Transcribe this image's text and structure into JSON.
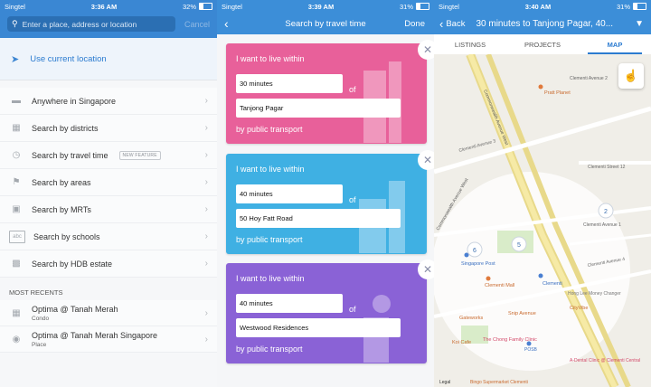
{
  "panel1": {
    "status": {
      "carrier": "Singtel",
      "time": "3:36 AM",
      "battery": "32%",
      "battery_level": 0.32
    },
    "search": {
      "placeholder": "Enter a place, address or location",
      "cancel": "Cancel"
    },
    "use_location": "Use current location",
    "menu": [
      {
        "label": "Anywhere in Singapore",
        "icon": "singapore-map-icon"
      },
      {
        "label": "Search by districts",
        "icon": "grid-icon"
      },
      {
        "label": "Search by travel time",
        "icon": "clock-icon",
        "badge": "NEW FEATURE"
      },
      {
        "label": "Search by areas",
        "icon": "area-icon"
      },
      {
        "label": "Search by MRTs",
        "icon": "train-icon"
      },
      {
        "label": "Search by schools",
        "icon": "school-icon"
      },
      {
        "label": "Search by HDB estate",
        "icon": "hdb-icon"
      }
    ],
    "recents_header": "MOST RECENTS",
    "recents": [
      {
        "title": "Optima @ Tanah Merah",
        "subtitle": "Condo"
      },
      {
        "title": "Optima @ Tanah Merah Singapore",
        "subtitle": "Place"
      }
    ]
  },
  "panel2": {
    "status": {
      "carrier": "Singtel",
      "time": "3:39 AM",
      "battery": "31%",
      "battery_level": 0.31
    },
    "title": "Search by travel time",
    "done": "Done",
    "cards": [
      {
        "intro": "I want to live within",
        "duration": "30 minutes",
        "of": "of",
        "place": "Tanjong Pagar",
        "mode": "by public transport",
        "color": "#e8609a"
      },
      {
        "intro": "I want to live within",
        "duration": "40 minutes",
        "of": "of",
        "place": "50 Hoy Fatt Road",
        "mode": "by public transport",
        "color": "#3fb0e3"
      },
      {
        "intro": "I want to live within",
        "duration": "40 minutes",
        "of": "of",
        "place": "Westwood Residences",
        "mode": "by public transport",
        "color": "#8a62d6"
      }
    ]
  },
  "panel3": {
    "status": {
      "carrier": "Singtel",
      "time": "3:40 AM",
      "battery": "31%",
      "battery_level": 0.31
    },
    "back": "Back",
    "title": "30 minutes to Tanjong Pagar, 40...",
    "tabs": [
      "LISTINGS",
      "PROJECTS",
      "MAP"
    ],
    "map_labels": {
      "road1": "Commonwealth Avenue West",
      "road2": "Commonwealth Avenue West",
      "road3": "Clementi Avenue 2",
      "road4": "Clementi Avenue 3",
      "road5": "Clementi Street 12",
      "road6": "Clementi Avenue 1",
      "road7": "Clementi Avenue 4",
      "poi1": "Pratt Planet",
      "poi2": "Singapore Post",
      "poi3": "Clementi Mall",
      "poi4": "Clementi",
      "poi5": "Snip Avenue",
      "poi6": "Gateworks",
      "poi7": "Koi Cafe",
      "poi8": "The Chong Family Clinic",
      "poi9": "CityVibe",
      "poi10": "Hong Lee Money Changer",
      "poi11": "POSB",
      "poi12": "A-Dental Clinic @ Clementi Central",
      "poi13": "Bingo Supermarket Clementi",
      "legal": "Legal",
      "cluster1": "2",
      "cluster2": "6",
      "cluster3": "5"
    }
  }
}
